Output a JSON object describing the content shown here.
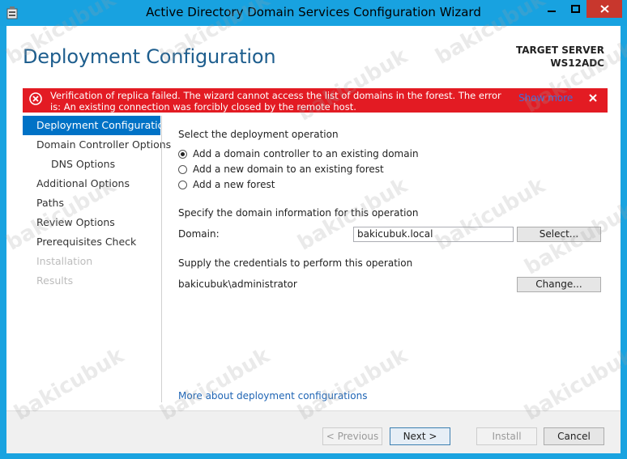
{
  "window": {
    "title": "Active Directory Domain Services Configuration Wizard"
  },
  "header": {
    "page_title": "Deployment Configuration",
    "target_server_label": "TARGET SERVER",
    "target_server_name": "WS12ADC"
  },
  "error_banner": {
    "message": "Verification of replica failed. The wizard cannot access the list of domains in the forest. The error is: An existing connection was forcibly closed by the remote host.",
    "show_more": "Show more"
  },
  "nav": {
    "items": [
      {
        "label": "Deployment Configuration"
      },
      {
        "label": "Domain Controller Options"
      },
      {
        "label": "DNS Options"
      },
      {
        "label": "Additional Options"
      },
      {
        "label": "Paths"
      },
      {
        "label": "Review Options"
      },
      {
        "label": "Prerequisites Check"
      },
      {
        "label": "Installation"
      },
      {
        "label": "Results"
      }
    ]
  },
  "main": {
    "operation_heading": "Select the deployment operation",
    "options": [
      {
        "label": "Add a domain controller to an existing domain",
        "selected": true
      },
      {
        "label": "Add a new domain to an existing forest",
        "selected": false
      },
      {
        "label": "Add a new forest",
        "selected": false
      }
    ],
    "domain_heading": "Specify the domain information for this operation",
    "domain_label": "Domain:",
    "domain_value": "bakicubuk.local",
    "select_button": "Select...",
    "credentials_heading": "Supply the credentials to perform this operation",
    "credentials_value": "bakicubuk\\administrator",
    "change_button": "Change...",
    "more_link": "More about deployment configurations"
  },
  "footer": {
    "previous": "< Previous",
    "next": "Next >",
    "install": "Install",
    "cancel": "Cancel"
  },
  "watermark": "bakicubuk",
  "colors": {
    "title_bar": "#18a2e0",
    "close_button": "#c8372d",
    "error_banner": "#e31b23",
    "nav_selected": "#0072c6",
    "page_title": "#1e5e8e",
    "link": "#1e64b4"
  }
}
